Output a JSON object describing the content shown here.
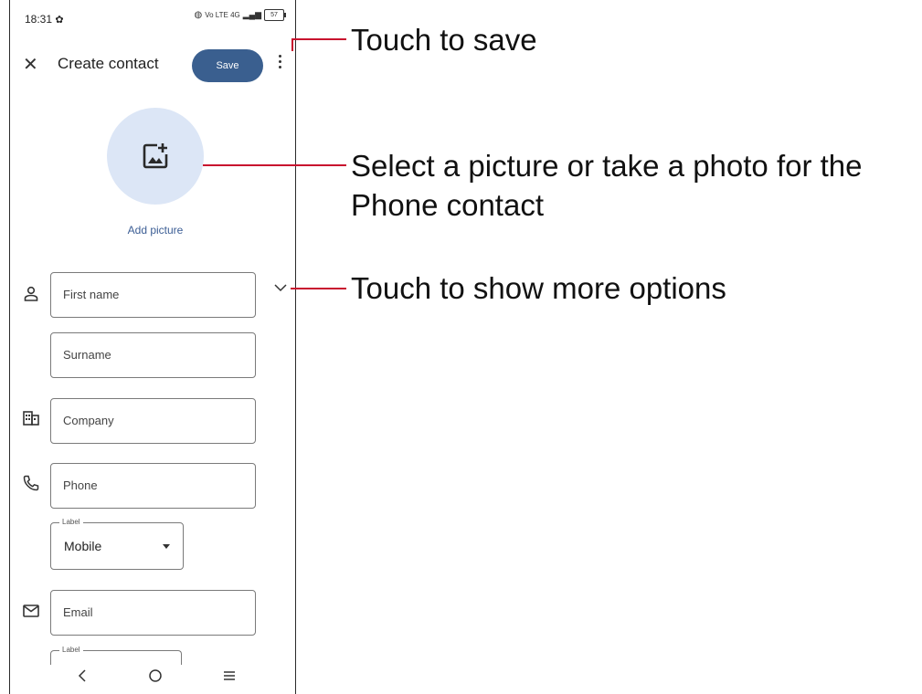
{
  "status_bar": {
    "time": "18:31",
    "network": "Vo LTE 4G",
    "battery": "57"
  },
  "toolbar": {
    "title": "Create contact",
    "save_label": "Save"
  },
  "photo": {
    "add_picture_label": "Add picture"
  },
  "fields": {
    "first_name": "First name",
    "surname": "Surname",
    "company": "Company",
    "phone": "Phone",
    "phone_label_caption": "Label",
    "phone_label_value": "Mobile",
    "email": "Email",
    "email_label_caption": "Label"
  },
  "annotations": {
    "save": "Touch to save",
    "picture_line1": "Select a picture or take a photo for the",
    "picture_line2": "Phone contact",
    "more": "Touch to show more options"
  },
  "colors": {
    "save_button": "#3a5f8f",
    "avatar_bg": "#dce6f6",
    "accent_text": "#3b5d94",
    "annotation_line": "#c8102e"
  }
}
